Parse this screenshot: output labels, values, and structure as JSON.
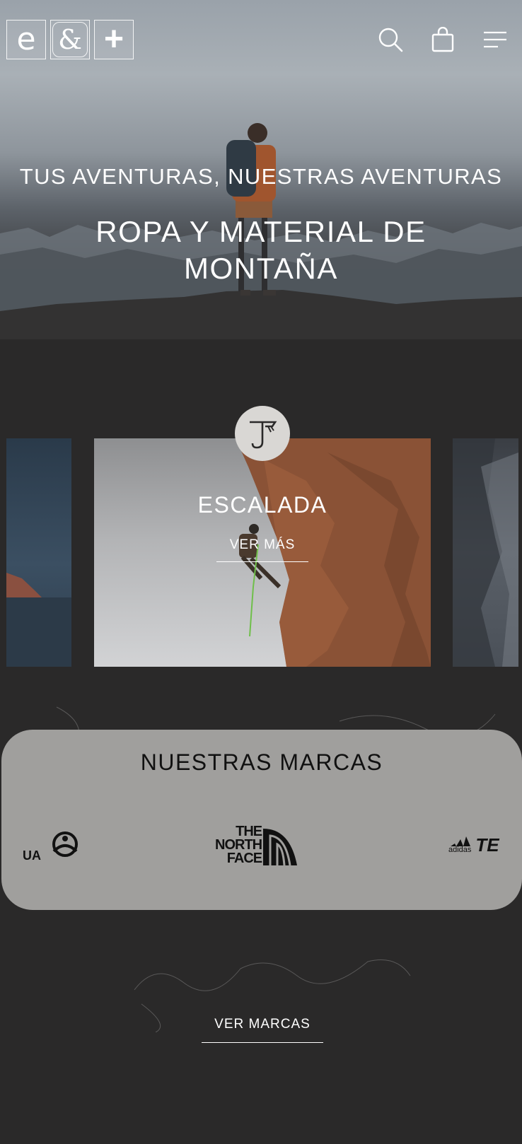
{
  "header": {
    "logo_letters": [
      "e",
      "&",
      "+"
    ],
    "icons": [
      "search-icon",
      "shopping-bag-icon",
      "menu-icon"
    ]
  },
  "hero": {
    "tagline": "TUS AVENTURAS, NUESTRAS AVENTURAS",
    "headline_line1": "ROPA Y MATERIAL DE",
    "headline_line2": "MONTAÑA"
  },
  "category": {
    "icon": "ice-axe-icon",
    "title": "ESCALADA",
    "link": "VER MÁS"
  },
  "brands": {
    "title": "NUESTRAS MARCAS",
    "logos": [
      {
        "name": "UA",
        "icon": "ua-brand-logo"
      },
      {
        "name_line1": "THE",
        "name_line2": "NORTH",
        "name_line3": "FACE",
        "icon": "the-north-face-logo"
      },
      {
        "name": "adidas",
        "suffix": "TE",
        "icon": "adidas-terrex-logo"
      }
    ],
    "link": "VER MARCAS"
  },
  "colors": {
    "background": "#2a2929",
    "brand_panel": "#a09f9d",
    "text": "#ffffff"
  }
}
